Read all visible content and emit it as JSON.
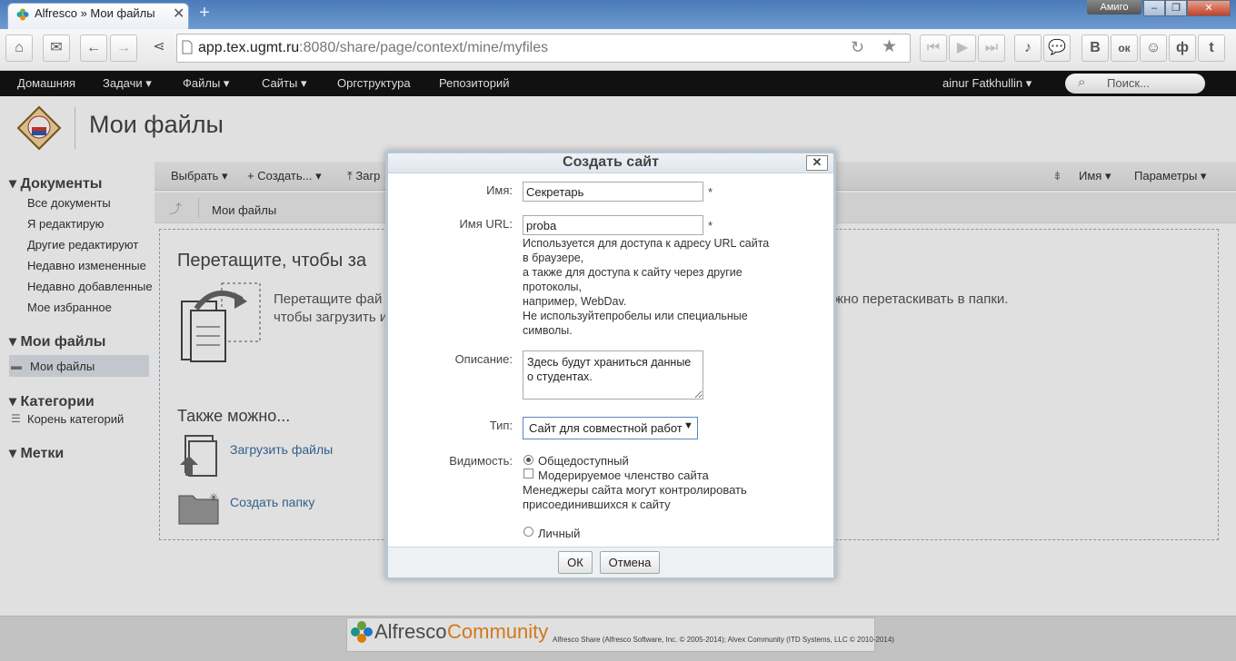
{
  "browser": {
    "tab_title": "Alfresco » Мои файлы",
    "user_badge": "Амиго",
    "url_host": "app.tex.ugmt.ru",
    "url_path": ":8080/share/page/context/mine/myfiles",
    "social": [
      "В",
      "ок",
      "ф",
      "t"
    ]
  },
  "appnav": {
    "items": [
      "Домашняя",
      "Задачи",
      "Файлы",
      "Сайты",
      "Оргструктура",
      "Репозиторий"
    ],
    "user": "ainur Fatkhullin",
    "search_placeholder": "Поиск..."
  },
  "page": {
    "title": "Мои файлы"
  },
  "sidebar": {
    "documents_header": "Документы",
    "documents": [
      "Все документы",
      "Я редактирую",
      "Другие редактируют",
      "Недавно измененные",
      "Недавно добавленные",
      "Мое избранное"
    ],
    "myfiles_header": "Мои файлы",
    "myfiles_item": "Мои файлы",
    "categories_header": "Категории",
    "categories_item": "Корень категорий",
    "tags_header": "Метки"
  },
  "doclist": {
    "select": "Выбрать",
    "create": "Создать...",
    "upload": "Загр",
    "sort": "Имя",
    "options": "Параметры",
    "breadcrumb": "Мои файлы",
    "drop_title": "Перетащите, чтобы за",
    "drop_text_1": "Перетащите фай",
    "drop_text_2": "чтобы загрузить и",
    "drop_text_right": "жно перетаскивать в папки.",
    "also": "Также можно...",
    "upload_link": "Загрузить файлы",
    "folder_link": "Создать папку"
  },
  "footer": {
    "brand_a": "Alfresco",
    "brand_b": "Community",
    "legal": "Alfresco Share (Alfresco Software, Inc. © 2005-2014); Alvex Community (ITD Systems, LLC © 2010-2014)"
  },
  "dialog": {
    "title": "Создать сайт",
    "close": "✕",
    "name_label": "Имя:",
    "name_value": "Секретарь",
    "url_label": "Имя URL:",
    "url_value": "proba",
    "url_help": [
      "Используется для доступа к адресу URL сайта",
      "в браузере,",
      "а также для доступа к сайту через другие",
      "протоколы,",
      "например, WebDav.",
      "Не используйтепробелы или специальные",
      "символы."
    ],
    "desc_label": "Описание:",
    "desc_value": "Здесь будут храниться данные о студентах.",
    "type_label": "Тип:",
    "type_value": "Сайт для совместной работ",
    "visibility_label": "Видимость:",
    "public": "Общедоступный",
    "moderated": "Модерируемое членство сайта",
    "moderated_help_1": "Менеджеры сайта могут контролировать",
    "moderated_help_2": "присоединившихся к сайту",
    "private": "Личный",
    "ok": "ОК",
    "cancel": "Отмена",
    "required": "*"
  }
}
